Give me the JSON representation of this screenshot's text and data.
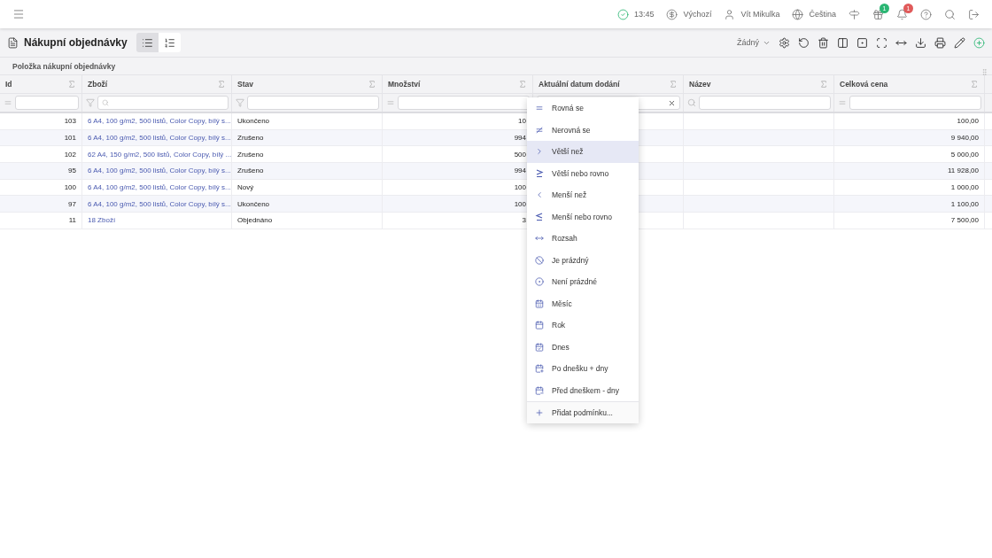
{
  "topbar": {
    "status_time": "13:45",
    "currency": "Výchozí",
    "user": "Vít Mikulka",
    "language": "Čeština",
    "gift_count": "1",
    "notification_count": "1"
  },
  "header": {
    "title": "Nákupní objednávky",
    "views": [
      {
        "kind": "list",
        "selected": true
      },
      {
        "kind": "ordered",
        "selected": false
      }
    ],
    "layout_select": "Žádný"
  },
  "section_label": "Položka nákupní objednávky",
  "table": {
    "columns": [
      {
        "label": "Id",
        "kind": "equals",
        "numeric": true
      },
      {
        "label": "Zboží",
        "kind": "search",
        "numeric": false
      },
      {
        "label": "Stav",
        "kind": "funnel",
        "numeric": false
      },
      {
        "label": "Množství",
        "kind": "equals",
        "numeric": true
      },
      {
        "label": "Aktuální datum dodání",
        "kind": "clear"
      },
      {
        "label": "Název",
        "kind": "magnifier"
      },
      {
        "label": "Celková cena",
        "kind": "equals",
        "numeric": true
      }
    ],
    "rows": [
      [
        "103",
        "6 A4, 100 g/m2, 500 listů, Color Copy, bílý s...",
        "Ukončeno",
        "10",
        "",
        "",
        "100,00"
      ],
      [
        "101",
        "6 A4, 100 g/m2, 500 listů, Color Copy, bílý s...",
        "Zrušeno",
        "994",
        "",
        "",
        "9 940,00"
      ],
      [
        "102",
        "62 A4, 150 g/m2, 500 listů, Color Copy, bílý ...",
        "Zrušeno",
        "500",
        "",
        "",
        "5 000,00"
      ],
      [
        "95",
        "6 A4, 100 g/m2, 500 listů, Color Copy, bílý s...",
        "Zrušeno",
        "994",
        "",
        "",
        "11 928,00"
      ],
      [
        "100",
        "6 A4, 100 g/m2, 500 listů, Color Copy, bílý s...",
        "Nový",
        "100",
        "",
        "",
        "1 000,00"
      ],
      [
        "97",
        "6 A4, 100 g/m2, 500 listů, Color Copy, bílý s...",
        "Ukončeno",
        "100",
        "",
        "",
        "1 100,00"
      ],
      [
        "11",
        "18 Zboží",
        "Objednáno",
        "3",
        "",
        "",
        "7 500,00"
      ]
    ]
  },
  "filter_menu": {
    "items": [
      {
        "label": "Rovná se",
        "kind": "eq",
        "selected": false
      },
      {
        "label": "Nerovná se",
        "kind": "ne",
        "selected": false
      },
      {
        "label": "Větší než",
        "kind": "gt",
        "selected": true
      },
      {
        "label": "Větší nebo rovno",
        "kind": "ge",
        "selected": false
      },
      {
        "label": "Menší než",
        "kind": "lt",
        "selected": false
      },
      {
        "label": "Menší nebo rovno",
        "kind": "le",
        "selected": false
      },
      {
        "label": "Rozsah",
        "kind": "range",
        "selected": false
      },
      {
        "label": "Je prázdný",
        "kind": "empty",
        "selected": false
      },
      {
        "label": "Není prázdné",
        "kind": "notempty",
        "selected": false
      },
      {
        "label": "Měsíc",
        "kind": "month",
        "selected": false
      },
      {
        "label": "Rok",
        "kind": "year",
        "selected": false
      },
      {
        "label": "Dnes",
        "kind": "today",
        "selected": false
      },
      {
        "label": "Po dnešku + dny",
        "kind": "after",
        "selected": false
      },
      {
        "label": "Před dneškem - dny",
        "kind": "before",
        "selected": false
      }
    ],
    "add_condition": "Přidat podmínku..."
  }
}
